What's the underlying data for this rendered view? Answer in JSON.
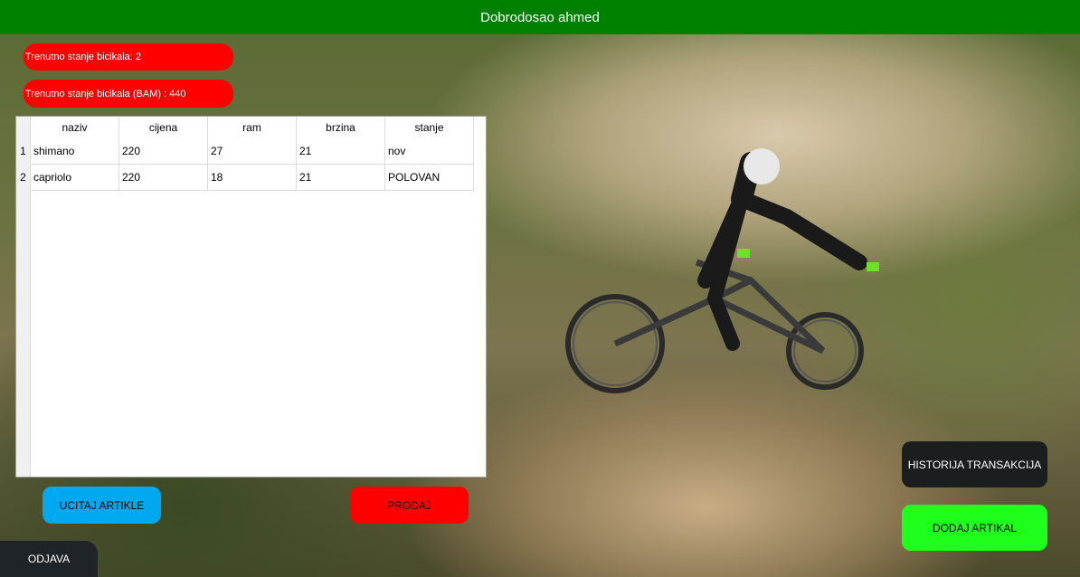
{
  "header": {
    "title": "Dobrodosao ahmed"
  },
  "stats": {
    "count_label": "Trenutno stanje bicikala: 2",
    "value_label": "Trenutno stanje bicikala (BAM) : 440"
  },
  "table": {
    "columns": [
      "naziv",
      "cijena",
      "ram",
      "brzina",
      "stanje"
    ],
    "rows": [
      {
        "index": "1",
        "cells": [
          "shimano",
          "220",
          "27",
          "21",
          "nov"
        ]
      },
      {
        "index": "2",
        "cells": [
          "capriolo",
          "220",
          "18",
          "21",
          "POLOVAN"
        ]
      }
    ]
  },
  "buttons": {
    "load": "UCITAJ ARTIKLE",
    "sell": "PRODAJ",
    "history": "HISTORIJA TRANSAKCIJA",
    "add": "DODAJ ARTIKAL",
    "logout": "ODJAVA"
  },
  "colors": {
    "header": "#008000",
    "stat_pill": "#ff0000",
    "load_button": "#00a8f0",
    "sell_button": "#ff0000",
    "history_button": "#1a1e1e",
    "add_button": "#1eff1e",
    "logout_button": "#1e2428"
  }
}
